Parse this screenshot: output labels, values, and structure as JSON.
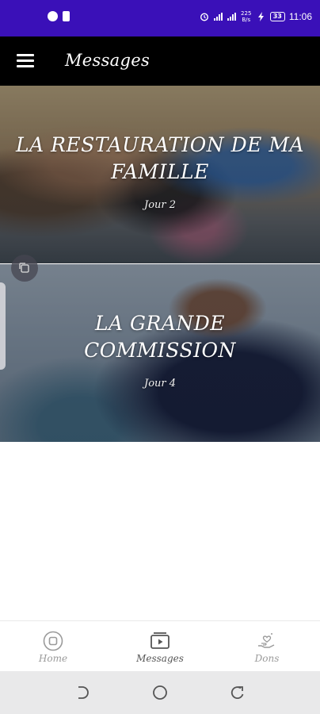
{
  "status_bar": {
    "time": "11:06",
    "battery": "33",
    "network_speed": "225 B/s"
  },
  "app_bar": {
    "title": "Messages",
    "menu_icon": "hamburger-menu-icon"
  },
  "messages": [
    {
      "title": "LA RESTAURATION DE MA FAMILLE",
      "subtitle": "Jour 2"
    },
    {
      "title": "LA GRANDE COMMISSION",
      "subtitle": "Jour 4"
    }
  ],
  "bottom_nav": {
    "items": [
      {
        "label": "Home",
        "icon": "home-circle-icon",
        "active": false
      },
      {
        "label": "Messages",
        "icon": "video-play-icon",
        "active": true
      },
      {
        "label": "Dons",
        "icon": "donation-hand-icon",
        "active": false
      }
    ]
  },
  "colors": {
    "status_bar": "#3a10b8",
    "app_bar": "#000000",
    "nav_inactive": "#9a9a9a",
    "nav_active": "#555555"
  }
}
